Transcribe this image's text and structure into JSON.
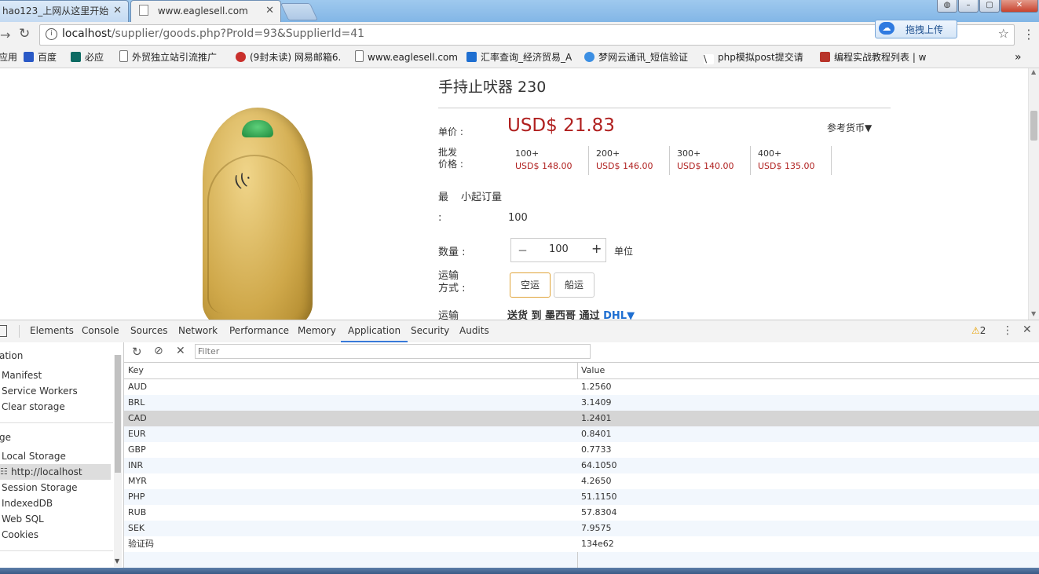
{
  "browser": {
    "tabs": [
      {
        "title": "hao123_上网从这里开始"
      },
      {
        "title": "www.eaglesell.com"
      }
    ],
    "url_host": "localhost",
    "url_path": "/supplier/goods.php?ProId=93&SupplierId=41",
    "upload_button": "拖拽上传",
    "bookmarks": [
      "应用",
      "百度",
      "必应",
      "外贸独立站引流推广",
      "(9封未读) 网易邮箱6.",
      "www.eaglesell.com",
      "汇率查询_经济贸易_A",
      "梦网云通讯_短信验证",
      "php模拟post提交请",
      "编程实战教程列表 | w"
    ]
  },
  "product": {
    "title": "手持止吠器 230",
    "unit_price_label": "单价 :",
    "unit_price": "USD$ 21.83",
    "currency_ref": "参考货币▼",
    "wholesale_label_1": "批发",
    "wholesale_label_2": "价格 :",
    "tiers": [
      {
        "qty": "100+",
        "price": "USD$ 148.00"
      },
      {
        "qty": "200+",
        "price": "USD$ 146.00"
      },
      {
        "qty": "300+",
        "price": "USD$ 140.00"
      },
      {
        "qty": "400+",
        "price": "USD$ 135.00"
      }
    ],
    "moq_label_a": "最",
    "moq_label_b": "小起订量",
    "moq_colon": ":",
    "moq_value": "100",
    "qty_label": "数量 :",
    "qty_minus": "－",
    "qty_value": "100",
    "qty_plus": "+",
    "qty_unit": "单位",
    "ship_label_1": "运输",
    "ship_label_2": "方式 :",
    "ship_air": "空运",
    "ship_sea": "船运",
    "ship2_label": "运输",
    "ship2_text": "送货 到 墨西哥 通过",
    "ship2_carrier": "DHL▼"
  },
  "devtools": {
    "tabs": [
      "Elements",
      "Console",
      "Sources",
      "Network",
      "Performance",
      "Memory",
      "Application",
      "Security",
      "Audits"
    ],
    "active_tab": "Application",
    "warning_count": "2",
    "filter_placeholder": "Filter",
    "sidebar": {
      "section1": "ation",
      "items1": [
        "Manifest",
        "Service Workers",
        "Clear storage"
      ],
      "section2": "ge",
      "items2": [
        "Local Storage",
        "http://localhost",
        "Session Storage",
        "IndexedDB",
        "Web SQL",
        "Cookies"
      ]
    },
    "table": {
      "headers": [
        "Key",
        "Value"
      ],
      "rows": [
        {
          "key": "AUD",
          "value": "1.2560"
        },
        {
          "key": "BRL",
          "value": "3.1409"
        },
        {
          "key": "CAD",
          "value": "1.2401"
        },
        {
          "key": "EUR",
          "value": "0.8401"
        },
        {
          "key": "GBP",
          "value": "0.7733"
        },
        {
          "key": "INR",
          "value": "64.1050"
        },
        {
          "key": "MYR",
          "value": "4.2650"
        },
        {
          "key": "PHP",
          "value": "51.1150"
        },
        {
          "key": "RUB",
          "value": "57.8304"
        },
        {
          "key": "SEK",
          "value": "7.9575"
        },
        {
          "key": "验证码",
          "value": "134e62"
        }
      ],
      "selected_row": 2
    }
  },
  "colors": {
    "price_red": "#b0201f",
    "accent_blue": "#3879d9",
    "dhl_blue": "#1f6fd1"
  }
}
